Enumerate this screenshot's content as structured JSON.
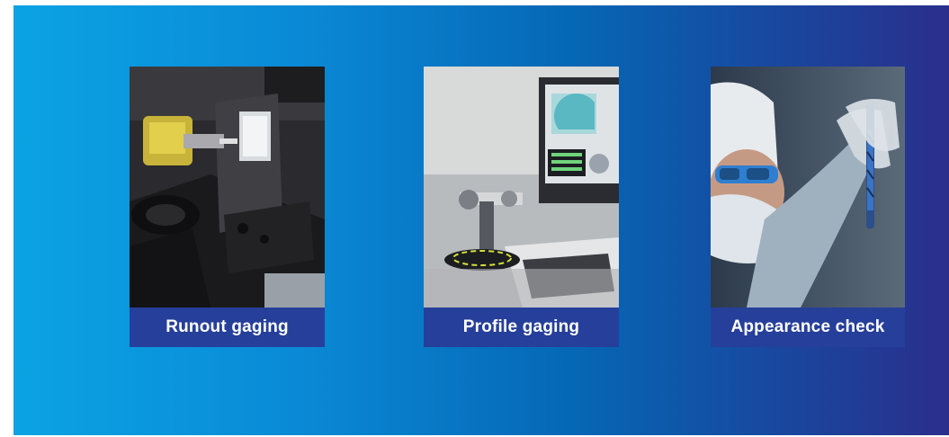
{
  "cards": [
    {
      "icon": "runout-gaging-machine-photo",
      "label": "Runout gaging"
    },
    {
      "icon": "profile-gaging-station-photo",
      "label": "Profile gaging"
    },
    {
      "icon": "technician-inspecting-end-mill-photo",
      "label": "Appearance check"
    }
  ],
  "colors": {
    "gradient_start": "#0ba3e3",
    "gradient_end": "#2a2f8c",
    "caption_bg": "#263f9a",
    "caption_text": "#ffffff"
  }
}
